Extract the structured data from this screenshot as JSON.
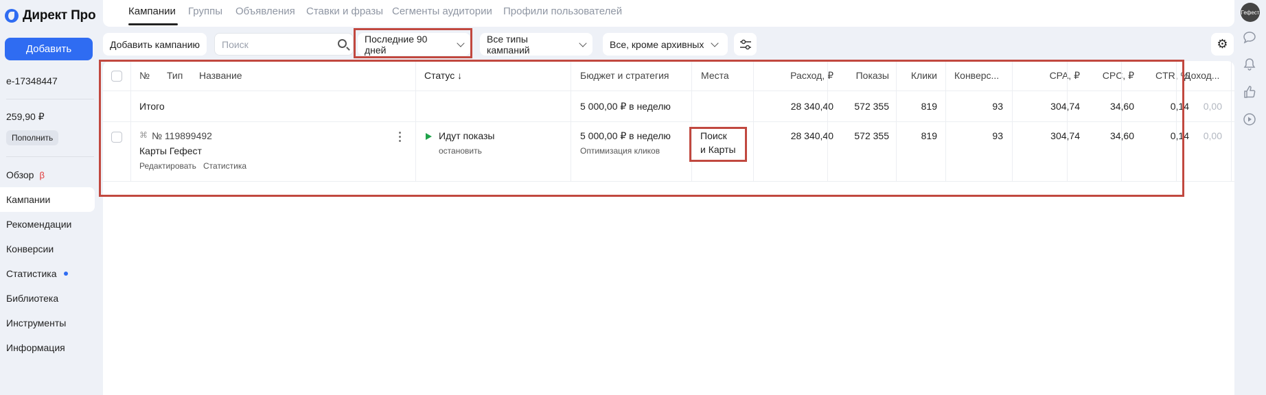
{
  "brand": {
    "name": "Директ Про"
  },
  "sidebar": {
    "add_label": "Добавить",
    "login": "e-17348447",
    "balance": "259,90 ₽",
    "topup_label": "Пополнить",
    "beta_mark": "β",
    "items": [
      {
        "label": "Обзор"
      },
      {
        "label": "Кампании"
      },
      {
        "label": "Рекомендации"
      },
      {
        "label": "Конверсии"
      },
      {
        "label": "Статистика"
      },
      {
        "label": "Библиотека"
      },
      {
        "label": "Инструменты"
      },
      {
        "label": "Информация"
      }
    ]
  },
  "tabs": [
    {
      "label": "Кампании"
    },
    {
      "label": "Группы"
    },
    {
      "label": "Объявления"
    },
    {
      "label": "Ставки и фразы"
    },
    {
      "label": "Сегменты аудитории"
    },
    {
      "label": "Профили пользователей"
    }
  ],
  "toolbar": {
    "add_campaign": "Добавить кампанию",
    "search_placeholder": "Поиск",
    "period": "Последние 90 дней",
    "campaign_types": "Все типы кампаний",
    "archive_filter": "Все, кроме архивных"
  },
  "table": {
    "headers": {
      "num": "№",
      "type": "Тип",
      "name": "Название",
      "status": "Статус ↓",
      "budget": "Бюджет и стратегия",
      "places": "Места",
      "spend": "Расход, ₽",
      "impressions": "Показы",
      "clicks": "Клики",
      "conversions": "Конверс...",
      "cpa": "CPA, ₽",
      "cpc": "CPC, ₽",
      "ctr": "CTR, %",
      "income": "Доход..."
    },
    "total": {
      "label": "Итого",
      "budget": "5 000,00 ₽ в неделю",
      "spend": "28 340,40",
      "impressions": "572 355",
      "clicks": "819",
      "conversions": "93",
      "cpa": "304,74",
      "cpc": "34,60",
      "ctr": "0,14",
      "income": "0,00"
    },
    "campaign": {
      "id": "№ 119899492",
      "name": "Карты Гефест",
      "edit_link": "Редактировать",
      "stats_link": "Статистика",
      "status": "Идут показы",
      "stop_link": "остановить",
      "budget": "5 000,00 ₽ в неделю",
      "strategy": "Оптимизация кликов",
      "places_line1": "Поиск",
      "places_line2": "и Карты",
      "spend": "28 340,40",
      "impressions": "572 355",
      "clicks": "819",
      "conversions": "93",
      "cpa": "304,74",
      "cpc": "34,60",
      "ctr": "0,14",
      "income": "0,00"
    }
  },
  "avatar_text": "Гефест",
  "colors": {
    "accent": "#2f6cf2",
    "highlight": "#c1483f",
    "status_active": "#1fa34a"
  }
}
